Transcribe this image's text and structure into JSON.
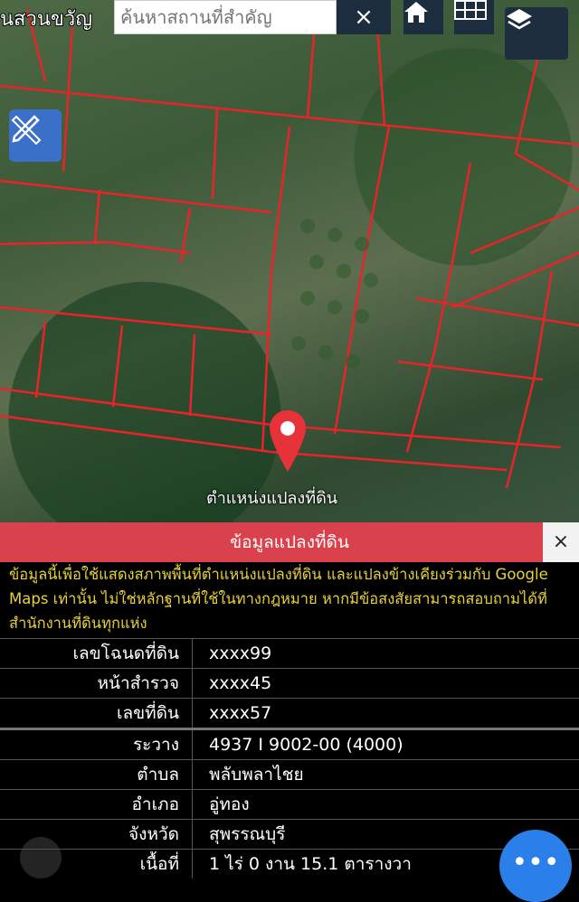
{
  "search": {
    "placeholder": "ค้นหาสถานที่สำคัญ",
    "clear_label": "×"
  },
  "map": {
    "partial_label": "นสวนขวัญ",
    "marker_label": "ตำแหน่งแปลงที่ดิน",
    "parcel_line_color": "#e8232a"
  },
  "panel": {
    "title": "ข้อมูลแปลงที่ดิน",
    "close_label": "×",
    "notice": "ข้อมูลนี้เพื่อใช้แสดงสภาพพื้นที่ตำแหน่งแปลงที่ดิน และแปลงข้างเคียงร่วมกับ Google Maps เท่านั้น ไม่ใช่หลักฐานที่ใช้ในทางกฎหมาย หากมีข้อสงสัยสามารถสอบถามได้ที่สำนักงานที่ดินทุกแห่ง",
    "rows": [
      {
        "label": "เลขโฉนดที่ดิน",
        "value": "xxxx99"
      },
      {
        "label": "หน้าสำรวจ",
        "value": "xxxx45"
      },
      {
        "label": "เลขที่ดิน",
        "value": "xxxx57"
      },
      {
        "label": "ระวาง",
        "value": "4937 I 9002-00 (4000)"
      },
      {
        "label": "ตำบล",
        "value": "พลับพลาไชย"
      },
      {
        "label": "อำเภอ",
        "value": "อู่ทอง"
      },
      {
        "label": "จังหวัด",
        "value": "สุพรรณบุรี"
      },
      {
        "label": "เนื้อที่",
        "value": "1 ไร่ 0 งาน 15.1 ตารางวา"
      }
    ]
  },
  "fab": {
    "label": "•••",
    "color": "#2a80e8"
  },
  "colors": {
    "header": "#d9414c",
    "notice_text": "#e8d23a"
  }
}
